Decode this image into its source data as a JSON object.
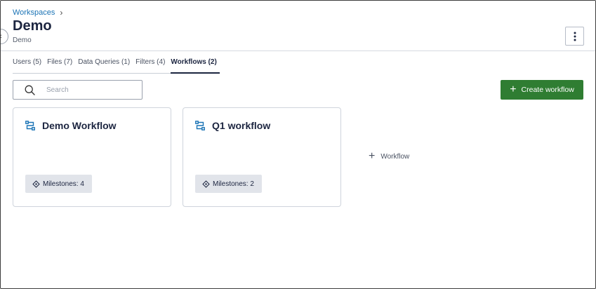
{
  "breadcrumb": {
    "root": "Workspaces"
  },
  "page": {
    "title": "Demo",
    "subtitle": "Demo"
  },
  "tabs": [
    {
      "label": "Users (5)",
      "active": false
    },
    {
      "label": "Files (7)",
      "active": false
    },
    {
      "label": "Data Queries (1)",
      "active": false
    },
    {
      "label": "Filters (4)",
      "active": false
    },
    {
      "label": "Workflows (2)",
      "active": true
    }
  ],
  "search": {
    "placeholder": "Search",
    "value": ""
  },
  "actions": {
    "create_label": "Create workflow",
    "add_label": "Workflow"
  },
  "workflows": [
    {
      "title": "Demo Workflow",
      "milestones": "Milestones: 4"
    },
    {
      "title": "Q1 workflow",
      "milestones": "Milestones: 2"
    }
  ],
  "colors": {
    "primary_button": "#2f7d32",
    "link": "#1a73b5",
    "workflow_icon": "#1a73b5",
    "badge_bg": "#e1e4ea"
  },
  "icons": {
    "collapse": "chevron-left-icon",
    "breadcrumb_separator": "chevron-right-icon",
    "more": "kebab-icon",
    "search": "search-icon",
    "workflow": "workflow-icon",
    "milestone": "milestone-icon",
    "add": "plus-icon"
  }
}
